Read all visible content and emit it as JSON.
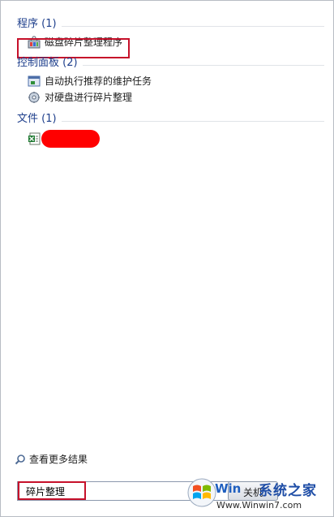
{
  "sections": [
    {
      "title": "程序 (1)",
      "items": [
        {
          "label": "磁盘碎片整理程序",
          "icon": "defrag-app-icon"
        }
      ]
    },
    {
      "title": "控制面板 (2)",
      "items": [
        {
          "label": "自动执行推荐的维护任务",
          "icon": "maintenance-icon"
        },
        {
          "label": "对硬盘进行碎片整理",
          "icon": "defrag-settings-icon"
        }
      ]
    },
    {
      "title": "文件 (1)",
      "items": [
        {
          "label": "",
          "icon": "excel-file-icon"
        }
      ]
    }
  ],
  "see_more": "查看更多结果",
  "search": {
    "value": "碎片整理"
  },
  "close_button": "关机",
  "watermark": {
    "brand": "系统之家",
    "url": "Www.Winwin7.com",
    "logo_text": "Win"
  },
  "colors": {
    "header": "#1e3f8c",
    "highlight": "#c6102a",
    "redaction": "#ff0000"
  }
}
